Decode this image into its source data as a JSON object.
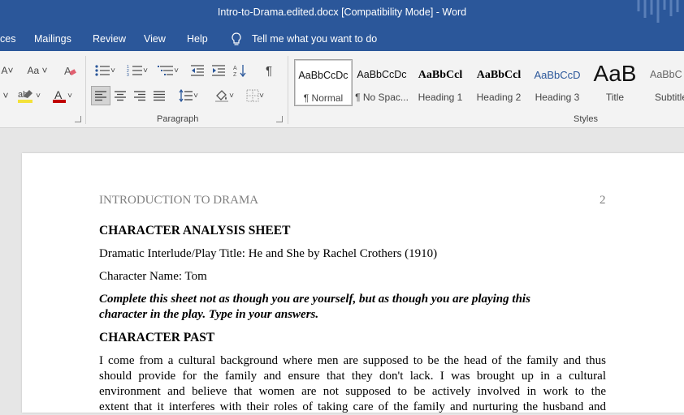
{
  "window": {
    "title": "Intro-to-Drama.edited.docx [Compatibility Mode]  -  Word"
  },
  "menu": {
    "items": [
      "ces",
      "Mailings",
      "Review",
      "View",
      "Help"
    ],
    "tell_me": "Tell me what you want to do"
  },
  "ribbon": {
    "font_size_label": "Aa",
    "paragraph_label": "Paragraph",
    "styles_label": "Styles",
    "styles": [
      {
        "preview": "AaBbCcDc",
        "name": "¶ Normal"
      },
      {
        "preview": "AaBbCcDc",
        "name": "¶ No Spac..."
      },
      {
        "preview": "AaBbCcl",
        "name": "Heading 1"
      },
      {
        "preview": "AaBbCcl",
        "name": "Heading 2"
      },
      {
        "preview": "AaBbCcD",
        "name": "Heading 3"
      },
      {
        "preview": "AaB",
        "name": "Title"
      },
      {
        "preview": "AaBbC",
        "name": "Subtitle"
      }
    ],
    "colors": {
      "highlight": "#f3e13a",
      "font_color": "#c00000"
    }
  },
  "document": {
    "header_left": "INTRODUCTION TO DRAMA",
    "page_number": "2",
    "heading1": "CHARACTER ANALYSIS SHEET",
    "play_title_line": "Dramatic Interlude/Play Title: He and She by Rachel Crothers (1910)",
    "character_name_line": "Character Name: Tom",
    "instruction_line1": "Complete this sheet not as though you are yourself, but as though you are playing this",
    "instruction_line2": "character in the play. Type in your answers.",
    "heading2": "CHARACTER PAST",
    "para_line1": "I come from a cultural background where men are supposed to be the head of the family and thus",
    "para_line2": "should provide for the family and ensure that they don't lack. I was brought up in a cultural",
    "para_line3": "environment and believe that women are not supposed to be actively involved in work to the",
    "para_line4": "extent that it interferes with their roles of taking care of the family and nurturing the husband and"
  },
  "colors": {
    "accent": "#2b579a",
    "ribbon_bg": "#f3f3f3",
    "canvas_bg": "#e6e6e6"
  }
}
